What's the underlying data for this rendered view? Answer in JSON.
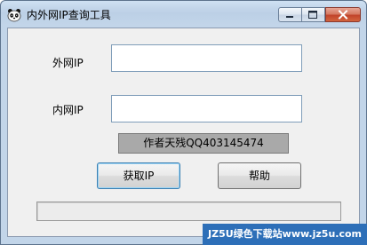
{
  "window": {
    "title": "内外网IP查询工具",
    "app_icon": "panda-icon"
  },
  "title_controls": {
    "minimize_icon": "minimize-icon",
    "maximize_icon": "maximize-icon",
    "close_icon": "close-icon"
  },
  "form": {
    "external_ip_label": "外网IP",
    "external_ip_value": "",
    "internal_ip_label": "内网IP",
    "internal_ip_value": ""
  },
  "banner": {
    "text": "作者天残QQ403145474"
  },
  "buttons": {
    "get_ip_label": "获取IP",
    "help_label": "帮助"
  },
  "status": {
    "text": ""
  },
  "watermark": {
    "text": "JZ5U绿色下载站www.jz5u.com"
  },
  "colors": {
    "title_frame": "#c3d6ea",
    "client_bg": "#f0f0f0",
    "banner_bg": "#a9a9a9",
    "close_button": "#c2442b",
    "watermark_bg": "#2d6fb8"
  }
}
